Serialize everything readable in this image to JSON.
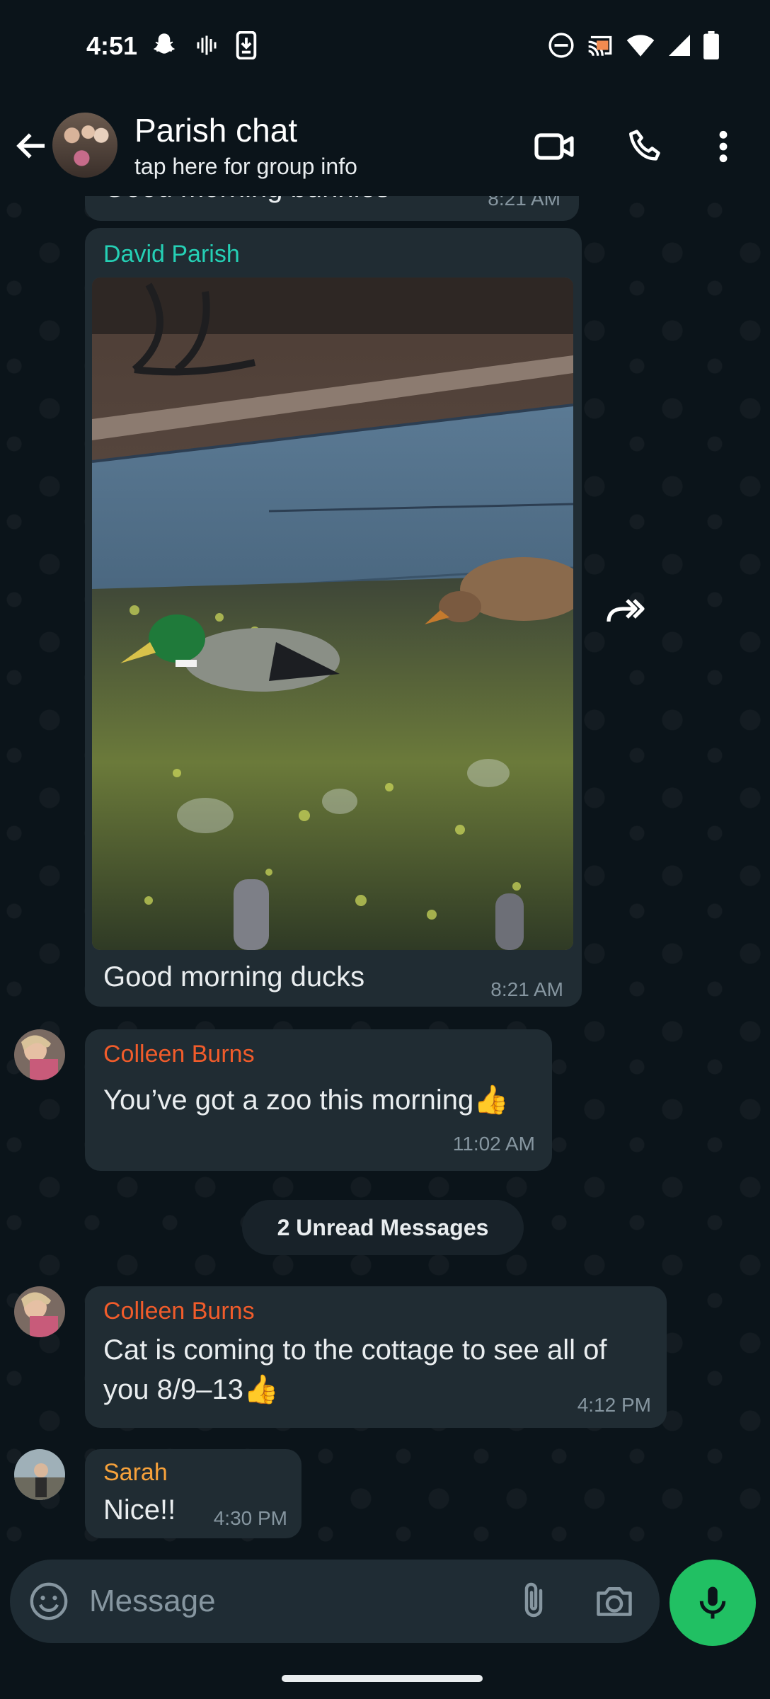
{
  "status_bar": {
    "time": "4:51",
    "left_icons": [
      "snapchat-icon",
      "audio-waveform-icon",
      "download-icon"
    ],
    "right_icons": [
      "do-not-disturb-icon",
      "cast-icon",
      "wifi-icon",
      "signal-icon",
      "battery-icon"
    ]
  },
  "header": {
    "title": "Parish chat",
    "subtitle": "tap here for group info",
    "icons": [
      "back-arrow-icon",
      "video-call-icon",
      "phone-call-icon",
      "more-vert-icon"
    ]
  },
  "messages": [
    {
      "type": "text",
      "text": "Good morning bunnies",
      "time": "8:21 AM"
    },
    {
      "type": "image",
      "sender": "David Parish",
      "sender_color": "#25d0b5",
      "caption": "Good morning ducks",
      "time": "8:21 AM"
    },
    {
      "type": "text",
      "sender": "Colleen Burns",
      "sender_color": "#f15c2b",
      "text": "You’ve got a zoo this morning",
      "emoji": "👍",
      "time": "11:02 AM"
    },
    {
      "type": "divider",
      "text": "2 Unread Messages"
    },
    {
      "type": "text",
      "sender": "Colleen Burns",
      "sender_color": "#f15c2b",
      "text_line1": "Cat is coming to the cottage to see all of",
      "text_line2": "you 8/9–13",
      "emoji": "👍",
      "time": "4:12 PM"
    },
    {
      "type": "text",
      "sender": "Sarah",
      "sender_color": "#f7a23b",
      "text": "Nice!!",
      "time": "4:30 PM"
    }
  ],
  "input": {
    "placeholder": "Message",
    "icons": [
      "emoji-icon",
      "attach-icon",
      "camera-icon",
      "mic-icon"
    ]
  },
  "colors": {
    "background": "#0b141a",
    "bubble": "#202c33",
    "accent_green": "#21c063",
    "meta_text": "#8696a0"
  }
}
